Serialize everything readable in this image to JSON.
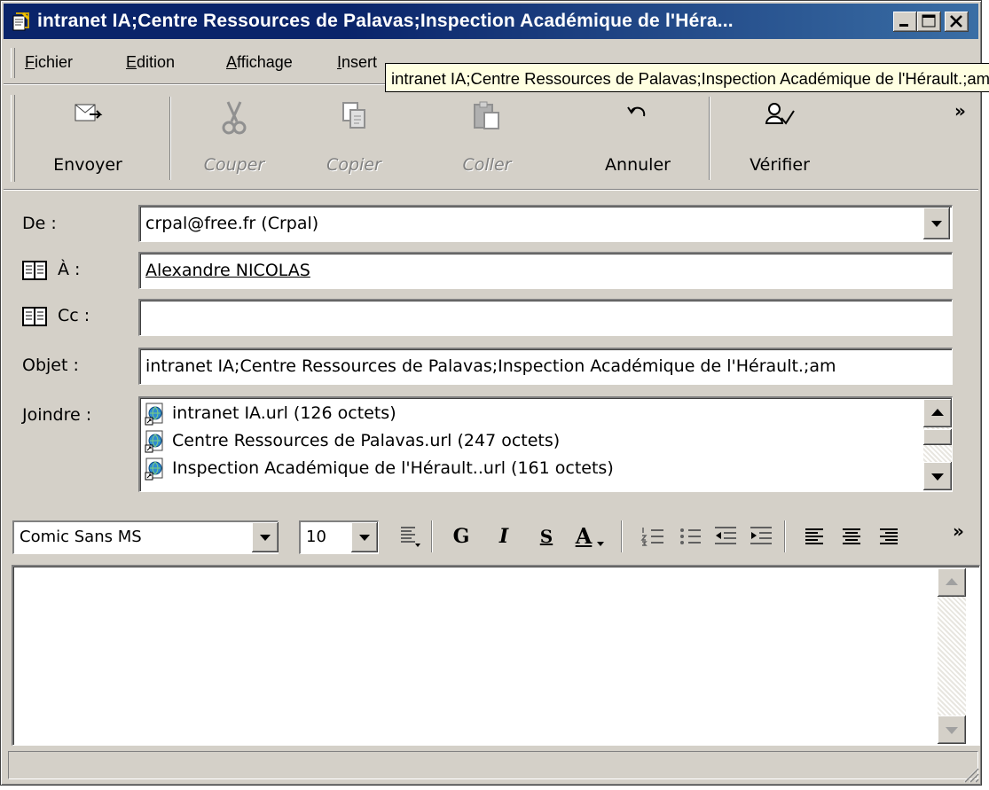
{
  "window": {
    "title": "intranet IA;Centre Ressources de Palavas;Inspection Académique de l'Héra..."
  },
  "menu": {
    "items": [
      {
        "ul": "F",
        "rest": "ichier"
      },
      {
        "ul": "E",
        "rest": "dition"
      },
      {
        "ul": "A",
        "rest": "ffichage"
      },
      {
        "ul": "I",
        "rest": "nsert"
      }
    ]
  },
  "tooltip": {
    "text": "intranet IA;Centre Ressources de Palavas;Inspection Académique de l'Hérault.;am"
  },
  "toolbar": {
    "buttons": [
      {
        "label": "Envoyer",
        "icon": "send-icon",
        "enabled": true
      },
      {
        "label": "Couper",
        "icon": "scissors-icon",
        "enabled": false
      },
      {
        "label": "Copier",
        "icon": "copy-icon",
        "enabled": false
      },
      {
        "label": "Coller",
        "icon": "paste-icon",
        "enabled": false
      },
      {
        "label": "Annuler",
        "icon": "undo-icon",
        "enabled": true
      },
      {
        "label": "Vérifier",
        "icon": "check-names-icon",
        "enabled": true
      }
    ],
    "overflow": "»"
  },
  "header": {
    "from_label": "De :",
    "from_value": "crpal@free.fr    (Crpal)",
    "to_label": "À :",
    "to_value": "Alexandre NICOLAS",
    "cc_label": "Cc :",
    "cc_value": "",
    "subject_label": "Objet :",
    "subject_value": "intranet IA;Centre Ressources de Palavas;Inspection Académique de l'Hérault.;am",
    "attach_label": "Joindre :"
  },
  "attachments": [
    "intranet IA.url (126 octets)",
    "Centre Ressources de Palavas.url (247 octets)",
    "Inspection Académique de l'Hérault..url (161 octets)"
  ],
  "format": {
    "font_name": "Comic Sans MS",
    "font_size": "10",
    "bold": "G",
    "italic": "I",
    "underline": "S",
    "font_color": "A",
    "overflow": "»"
  },
  "body": {
    "text": ""
  },
  "status": {
    "text": ""
  },
  "colors": {
    "title_bar": "#0a246a",
    "face": "#d4d0c8",
    "tooltip": "#ffffe1"
  }
}
